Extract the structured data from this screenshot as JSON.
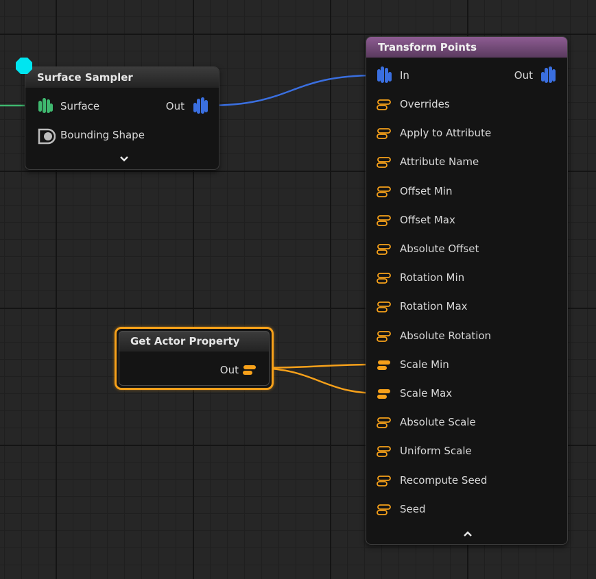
{
  "colors": {
    "points_pin_blue": "#3a6fe0",
    "surface_pin_green": "#3fb86f",
    "attribute_pin_orange": "#f7a11a",
    "exec_pin_cyan": "#00e5f0",
    "transform_header": "#8d5c92",
    "selected_outline": "#f7a11a"
  },
  "surface_sampler": {
    "title": "Surface Sampler",
    "pins": {
      "surface": "Surface",
      "bounding_shape": "Bounding Shape",
      "out": "Out"
    },
    "expand_icon": "chevron-down-icon"
  },
  "get_actor_property": {
    "title": "Get Actor Property",
    "out": "Out",
    "selected": true
  },
  "transform_points": {
    "title": "Transform Points",
    "in": "In",
    "out": "Out",
    "pins": [
      "Overrides",
      "Apply to Attribute",
      "Attribute Name",
      "Offset Min",
      "Offset Max",
      "Absolute Offset",
      "Rotation Min",
      "Rotation Max",
      "Absolute Rotation",
      "Scale Min",
      "Scale Max",
      "Absolute Scale",
      "Uniform Scale",
      "Recompute Seed",
      "Seed"
    ],
    "connected_pins": [
      "Scale Min",
      "Scale Max"
    ],
    "collapse_icon": "chevron-up-icon"
  }
}
